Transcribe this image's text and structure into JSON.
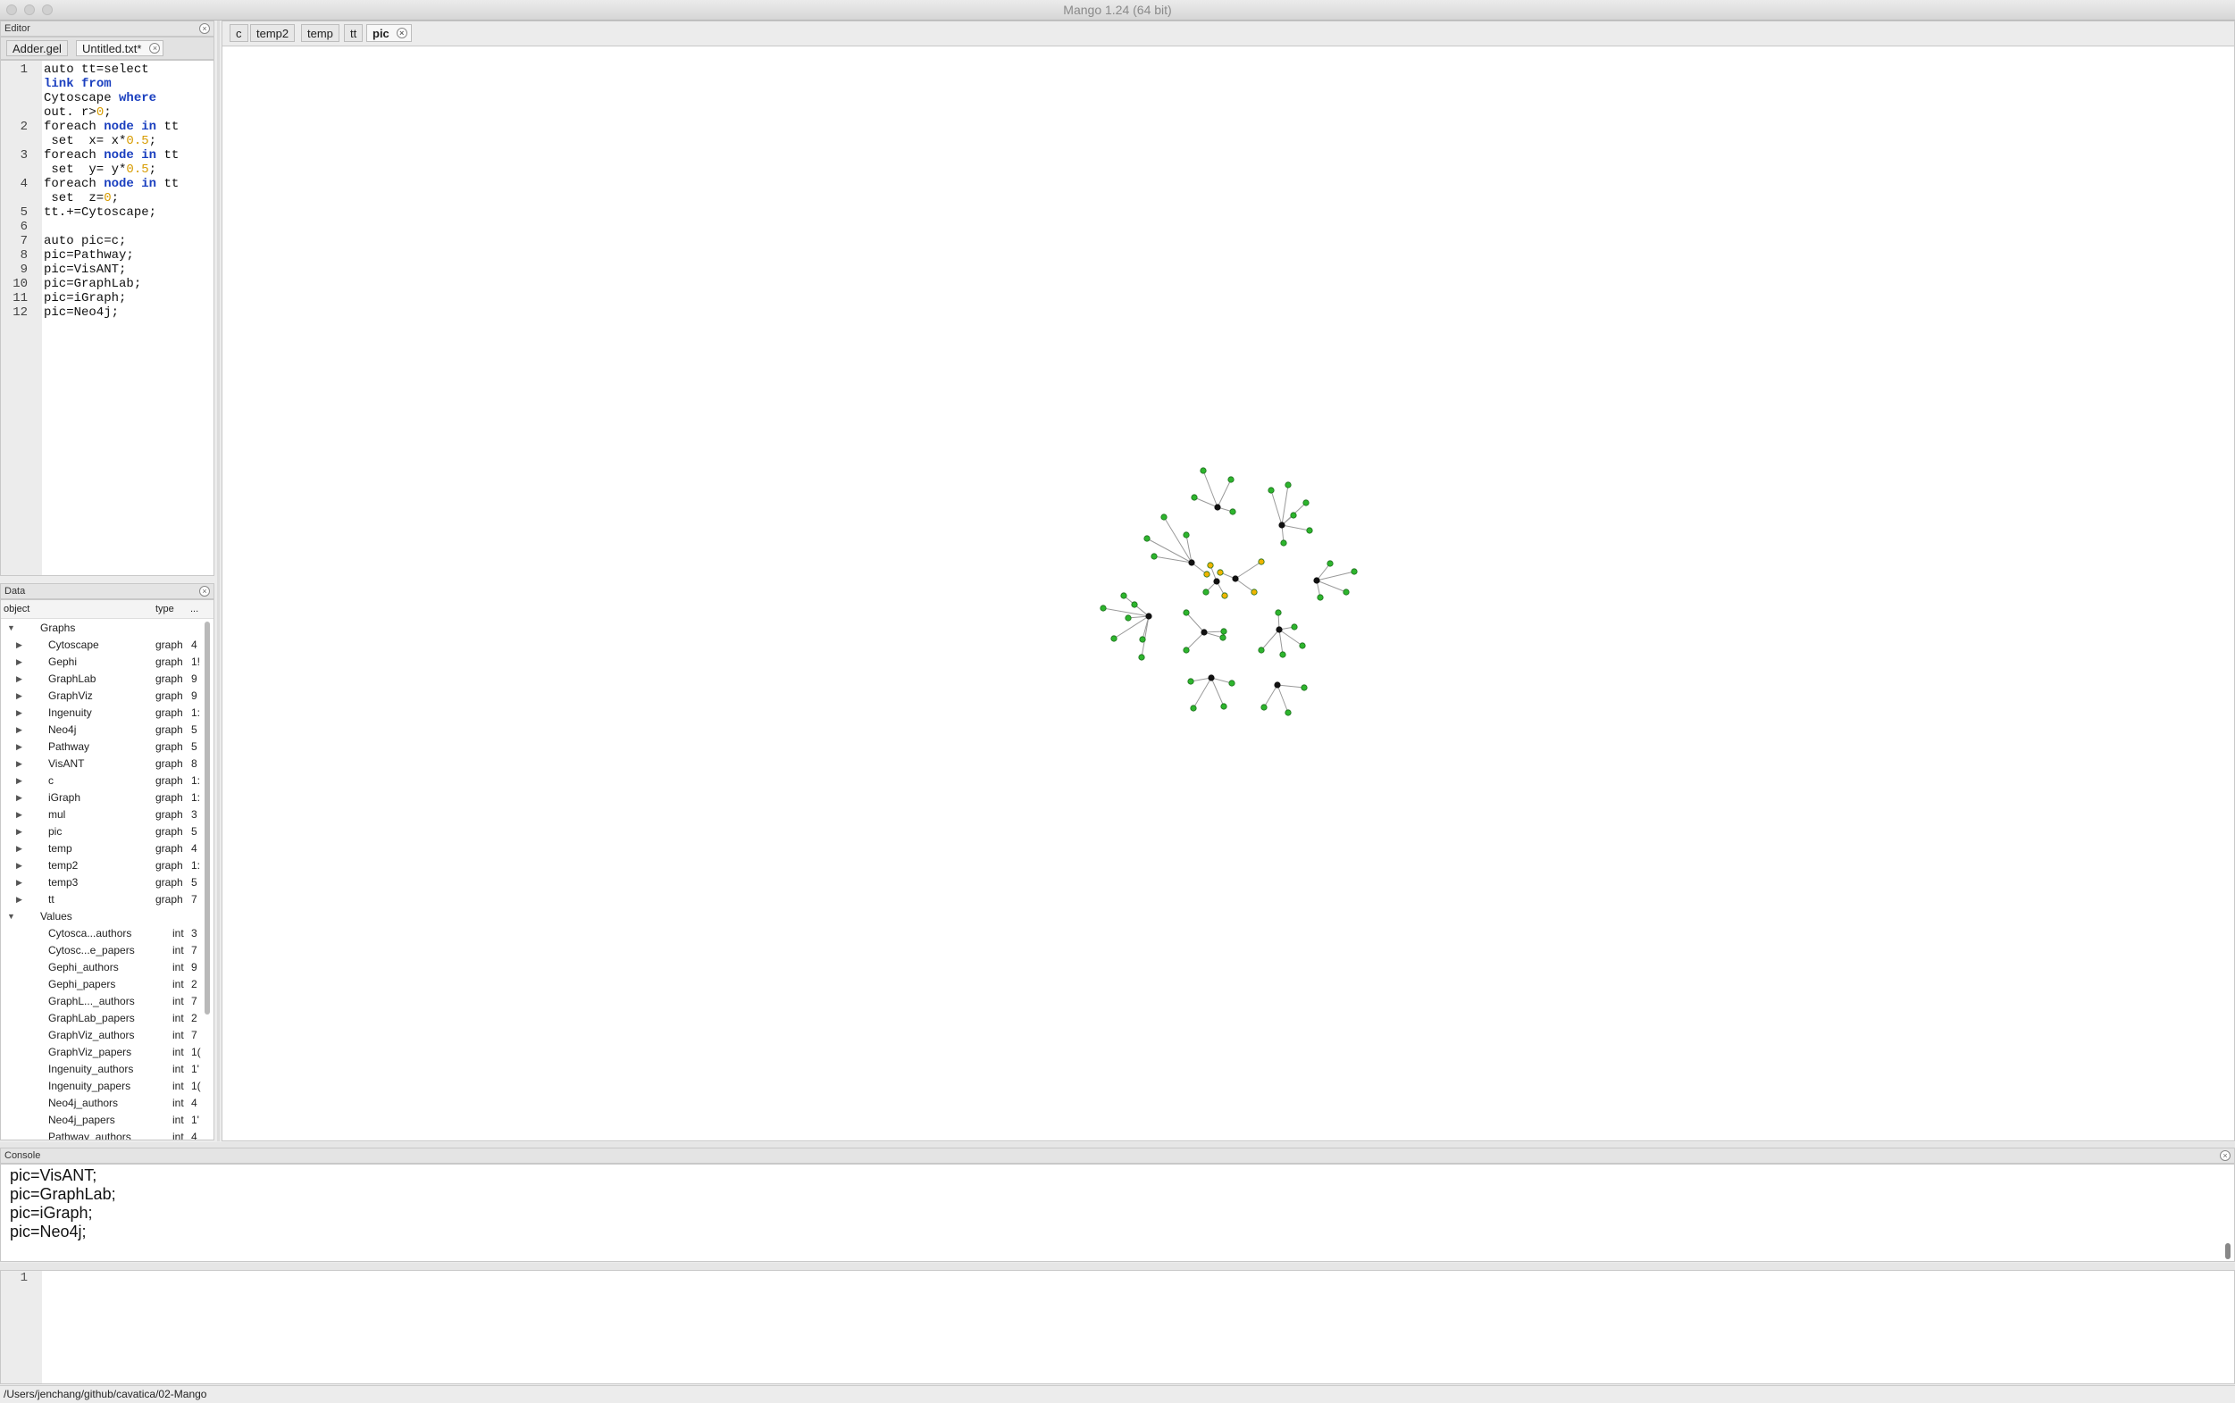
{
  "window": {
    "title": "Mango 1.24 (64 bit)"
  },
  "editor": {
    "panel_title": "Editor",
    "tabs": [
      {
        "label": "Adder.gel"
      },
      {
        "label": "Untitled.txt*"
      }
    ],
    "line_numbers": [
      "1",
      "2",
      "3",
      "4",
      "5",
      "6",
      "7",
      "8",
      "9",
      "10",
      "11",
      "12"
    ],
    "code": [
      "auto tt=select",
      "link from",
      "Cytoscape where",
      "out. r>0;",
      "foreach node in tt",
      " set  x= x*0.5;",
      "foreach node in tt",
      " set  y= y*0.5;",
      "foreach node in tt",
      " set  z=0;",
      "tt.+=Cytoscape;",
      "",
      "auto pic=c;",
      "pic=Pathway;",
      "pic=VisANT;",
      "pic=GraphLab;",
      "pic=iGraph;",
      "pic=Neo4j;"
    ]
  },
  "data_panel": {
    "panel_title": "Data",
    "columns": {
      "object": "object",
      "type": "type",
      "extra": "..."
    },
    "graphs_label": "Graphs",
    "graphs": [
      {
        "name": "Cytoscape",
        "type": "graph",
        "count": "4"
      },
      {
        "name": "Gephi",
        "type": "graph",
        "count": "1!"
      },
      {
        "name": "GraphLab",
        "type": "graph",
        "count": "9"
      },
      {
        "name": "GraphViz",
        "type": "graph",
        "count": "9"
      },
      {
        "name": "Ingenuity",
        "type": "graph",
        "count": "1:"
      },
      {
        "name": "Neo4j",
        "type": "graph",
        "count": "5"
      },
      {
        "name": "Pathway",
        "type": "graph",
        "count": "5"
      },
      {
        "name": "VisANT",
        "type": "graph",
        "count": "8"
      },
      {
        "name": "c",
        "type": "graph",
        "count": "1:"
      },
      {
        "name": "iGraph",
        "type": "graph",
        "count": "1:"
      },
      {
        "name": "mul",
        "type": "graph",
        "count": "3"
      },
      {
        "name": "pic",
        "type": "graph",
        "count": "5"
      },
      {
        "name": "temp",
        "type": "graph",
        "count": "4"
      },
      {
        "name": "temp2",
        "type": "graph",
        "count": "1:"
      },
      {
        "name": "temp3",
        "type": "graph",
        "count": "5"
      },
      {
        "name": "tt",
        "type": "graph",
        "count": "7"
      }
    ],
    "values_label": "Values",
    "values": [
      {
        "name": "Cytosca...authors",
        "type": "int",
        "count": "3"
      },
      {
        "name": "Cytosc...e_papers",
        "type": "int",
        "count": "7"
      },
      {
        "name": "Gephi_authors",
        "type": "int",
        "count": "9"
      },
      {
        "name": "Gephi_papers",
        "type": "int",
        "count": "2"
      },
      {
        "name": "GraphL..._authors",
        "type": "int",
        "count": "7"
      },
      {
        "name": "GraphLab_papers",
        "type": "int",
        "count": "2"
      },
      {
        "name": "GraphViz_authors",
        "type": "int",
        "count": "7"
      },
      {
        "name": "GraphViz_papers",
        "type": "int",
        "count": "1("
      },
      {
        "name": "Ingenuity_authors",
        "type": "int",
        "count": "1'"
      },
      {
        "name": "Ingenuity_papers",
        "type": "int",
        "count": "1("
      },
      {
        "name": "Neo4j_authors",
        "type": "int",
        "count": "4"
      },
      {
        "name": "Neo4j_papers",
        "type": "int",
        "count": "1'"
      },
      {
        "name": "Pathway_authors",
        "type": "int",
        "count": "4"
      }
    ]
  },
  "main_tabs": [
    {
      "label": "c"
    },
    {
      "label": "temp2"
    },
    {
      "label": "temp"
    },
    {
      "label": "tt"
    },
    {
      "label": "pic"
    }
  ],
  "console": {
    "panel_title": "Console",
    "lines": [
      "pic=VisANT;",
      "pic=GraphLab;",
      "pic=iGraph;",
      "pic=Neo4j;"
    ],
    "input_line_number": "1"
  },
  "status_bar": {
    "path": "/Users/jenchang/github/cavatica/02-Mango"
  },
  "colors": {
    "hub": "#111111",
    "leaf": "#2db52d",
    "highlight": "#f0b400",
    "edge": "#9a9a9a"
  }
}
